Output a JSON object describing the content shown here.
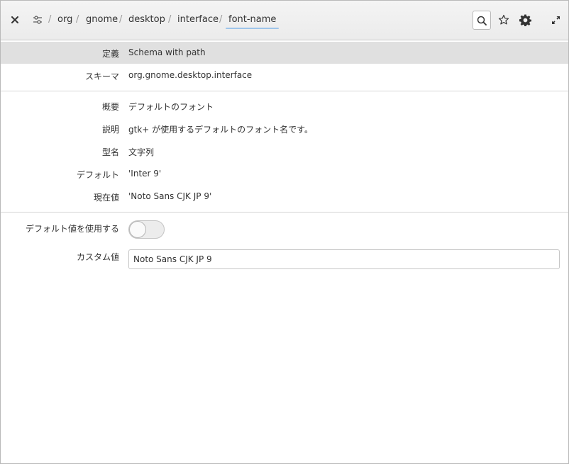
{
  "header": {
    "close_icon": "close-icon",
    "settings_icon": "settings-sliders-icon",
    "breadcrumbs": [
      "org",
      "gnome",
      "desktop",
      "interface",
      "font-name"
    ],
    "separator": "/",
    "search_icon": "search-icon",
    "bookmark_icon": "star-icon",
    "gear_icon": "gear-icon",
    "fullscreen_icon": "fullscreen-icon"
  },
  "info": {
    "definition_label": "定義",
    "definition_value": "Schema with path",
    "schema_label": "スキーマ",
    "schema_value": "org.gnome.desktop.interface",
    "summary_label": "概要",
    "summary_value": "デフォルトのフォント",
    "description_label": "説明",
    "description_value": "gtk+ が使用するデフォルトのフォント名です。",
    "type_label": "型名",
    "type_value": "文字列",
    "default_label": "デフォルト",
    "default_value": "'Inter 9'",
    "current_label": "現在値",
    "current_value": "'Noto Sans CJK JP 9'"
  },
  "edit": {
    "use_default_label": "デフォルト値を使用する",
    "use_default_on": false,
    "custom_label": "カスタム値",
    "custom_value": "Noto Sans CJK JP 9"
  }
}
